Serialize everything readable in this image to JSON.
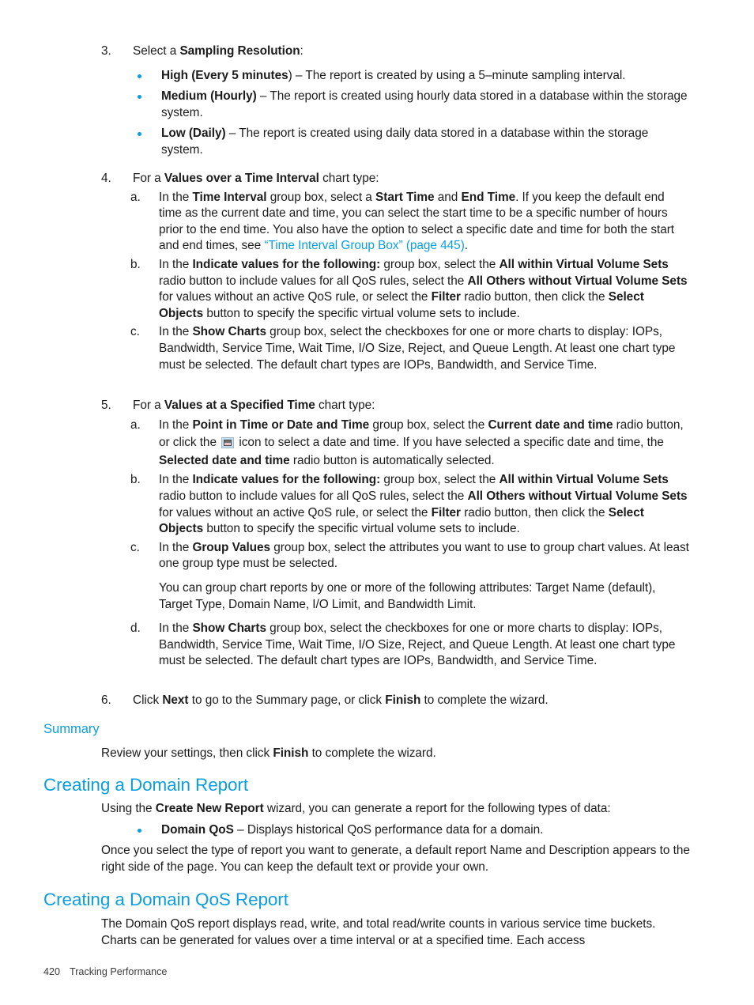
{
  "colors": {
    "accent": "#0c9fe0",
    "body_text": "#1c1c1c",
    "footer_text": "#3a3a3a"
  },
  "steps": {
    "step3": {
      "number": "3.",
      "lead_pre": "Select a ",
      "lead_bold": "Sampling Resolution",
      "lead_post": ":",
      "bullets": [
        {
          "bold": "High (Every 5 minutes",
          "text": ") – The report is created by using a 5–minute sampling interval."
        },
        {
          "bold": "Medium (Hourly)",
          "text": " – The report is created using hourly data stored in a database within the storage system."
        },
        {
          "bold": "Low (Daily)",
          "text": " – The report is created using daily data stored in a database within the storage system."
        }
      ]
    },
    "step4": {
      "number": "4.",
      "lead_pre": "For a ",
      "lead_bold": "Values over a Time Interval",
      "lead_post": " chart type:",
      "sub_a": {
        "marker": "a.",
        "p1": "In the ",
        "b1": "Time Interval",
        "p2": " group box, select a ",
        "b2": "Start Time",
        "p3": " and ",
        "b3": "End Time",
        "p4": ". If you keep the default end time as the current date and time, you can select the start time to be a specific number of hours prior to the end time. You also have the option to select a specific date and time for both the start and end times, see ",
        "link": "“Time Interval Group Box” (page 445)",
        "p5": "."
      },
      "sub_b": {
        "marker": "b.",
        "p1": "In the ",
        "b1": "Indicate values for the following:",
        "p2": " group box, select the ",
        "b2": "All within Virtual Volume Sets",
        "p3": " radio button to include values for all QoS rules, select the ",
        "b3": "All Others without Virtual Volume Sets",
        "p4": " for values without an active QoS rule, or select the ",
        "b4": "Filter",
        "p5": " radio button, then click the ",
        "b5": "Select Objects",
        "p6": " button to specify the specific virtual volume sets to include."
      },
      "sub_c": {
        "marker": "c.",
        "p1": "In the ",
        "b1": "Show Charts",
        "p2": " group box, select the checkboxes for one or more charts to display: IOPs, Bandwidth, Service Time, Wait Time, I/O Size, Reject, and Queue Length. At least one chart type must be selected. The default chart types are IOPs, Bandwidth, and Service Time."
      }
    },
    "step5": {
      "number": "5.",
      "lead_pre": "For a ",
      "lead_bold": "Values at a Specified Time",
      "lead_post": " chart type:",
      "sub_a": {
        "marker": "a.",
        "p1": "In the ",
        "b1": "Point in Time or Date and Time",
        "p2": " group box, select the ",
        "b2": "Current date and time",
        "p3": " radio button, or click the ",
        "icon_name": "calendar-icon",
        "p4": " icon to select a date and time. If you have selected a specific date and time, the ",
        "b3": "Selected date and time",
        "p5": " radio button is automatically selected."
      },
      "sub_b": {
        "marker": "b.",
        "p1": "In the ",
        "b1": "Indicate values for the following:",
        "p2": " group box, select the ",
        "b2": "All within Virtual Volume Sets",
        "p3": " radio button to include values for all QoS rules, select the ",
        "b3": "All Others without Virtual Volume Sets",
        "p4": " for values without an active QoS rule, or select the ",
        "b4": "Filter",
        "p5": " radio button, then click the ",
        "b5": "Select Objects",
        "p6": " button to specify the specific virtual volume sets to include."
      },
      "sub_c": {
        "marker": "c.",
        "p1": "In the ",
        "b1": "Group Values",
        "p2": " group box, select the attributes you want to use to group chart values. At least one group type must be selected.",
        "para2": "You can group chart reports by one or more of the following attributes: Target Name (default), Target Type, Domain Name, I/O Limit, and Bandwidth Limit."
      },
      "sub_d": {
        "marker": "d.",
        "p1": "In the ",
        "b1": "Show Charts",
        "p2": " group box, select the checkboxes for one or more charts to display: IOPs, Bandwidth, Service Time, Wait Time, I/O Size, Reject, and Queue Length. At least one chart type must be selected. The default chart types are IOPs, Bandwidth, and Service Time."
      }
    },
    "step6": {
      "number": "6.",
      "p1": "Click ",
      "b1": "Next",
      "p2": " to go to the Summary page, or click ",
      "b2": "Finish",
      "p3": " to complete the wizard."
    }
  },
  "sections": {
    "summary": {
      "heading": "Summary",
      "p1": "Review your settings, then click ",
      "b1": "Finish",
      "p2": " to complete the wizard."
    },
    "domain_report": {
      "heading": "Creating a Domain Report",
      "intro_p1": "Using the ",
      "intro_b1": "Create New Report",
      "intro_p2": " wizard, you can generate a report for the following types of data:",
      "bullet_bold": "Domain QoS",
      "bullet_text": " – Displays historical QoS performance data for a domain.",
      "closing": "Once you select the type of report you want to generate, a default report Name and Description appears to the right side of the page. You can keep the default text or provide your own."
    },
    "domain_qos_report": {
      "heading": "Creating a Domain QoS Report",
      "body": "The Domain QoS report displays read, write, and total read/write counts in various service time buckets. Charts can be generated for values over a time interval or at a specified time. Each access"
    }
  },
  "footer": {
    "page_number": "420",
    "chapter": "Tracking Performance"
  }
}
